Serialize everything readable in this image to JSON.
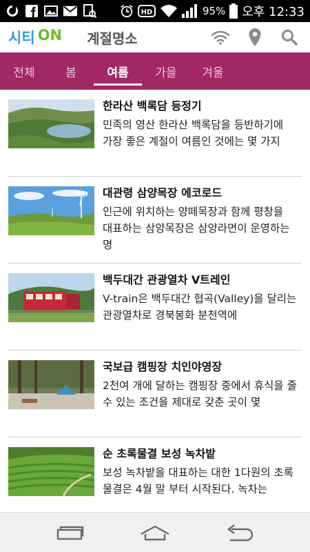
{
  "status_bar": {
    "battery": "95%",
    "time": "오후 12:33",
    "icons": [
      "circle-notification-icon",
      "facebook-icon",
      "image-icon",
      "mail-icon",
      "screenshot-icon",
      "alarm-icon",
      "hd-icon",
      "wifi-icon",
      "signal-icon",
      "battery-icon"
    ]
  },
  "header": {
    "logo_part1": "시티",
    "logo_part2": "ON",
    "title": "계절명소",
    "icons": [
      "wifi-icon",
      "location-pin-icon",
      "search-icon"
    ],
    "colors": {
      "logo_blue": "#2a9fd8",
      "logo_green": "#6cbb2c",
      "tab_bg": "#a22865"
    }
  },
  "tabs": [
    {
      "label": "전체",
      "active": false
    },
    {
      "label": "봄",
      "active": false
    },
    {
      "label": "여름",
      "active": true
    },
    {
      "label": "가을",
      "active": false
    },
    {
      "label": "겨울",
      "active": false
    }
  ],
  "items": [
    {
      "title": "한라산 백록담 등정기",
      "desc": "민족의 영산 한라산 백록담을 등반하기에 가장 좋은 계절이 여름인 것에는 몇 가지"
    },
    {
      "title": "대관령 삼양목장 에코로드",
      "desc": "인근에 위치하는 양떼목장과 함께 평창을 대표하는 삼양목장은 삼양라면이 운영하는 명"
    },
    {
      "title": "백두대간 관광열차 V트레인",
      "desc": "V-train은 백두대간 협곡(Valley)을 달리는 관광열차로 경북봉화 분천역에"
    },
    {
      "title": "국보급 캠핑장 치인야영장",
      "desc": "2천여 개에 달하는 캠핑장 중에서 휴식을 줄 수 있는 조건을 제대로 갖춘 곳이 몇"
    },
    {
      "title": "순 초록물결 보성 녹차밭",
      "desc": "보성 녹차밭을 대표하는 대한 1다원의 초록 물결은 4월 말 부터 시작된다. 녹차는"
    }
  ],
  "navbar": {
    "icons": [
      "recent-apps-icon",
      "home-icon",
      "back-icon"
    ]
  }
}
